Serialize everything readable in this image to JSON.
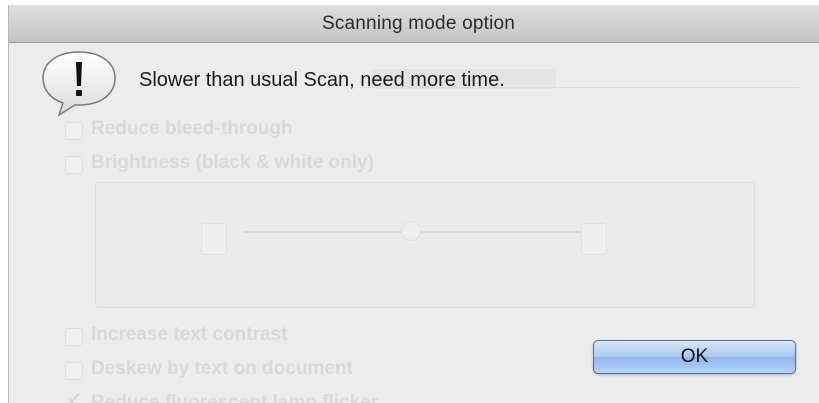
{
  "window": {
    "title": "Scanning mode option"
  },
  "alert": {
    "icon": "exclamation-icon",
    "message": "Slower than usual Scan, need more time."
  },
  "buttons": {
    "ok_label": "OK"
  },
  "background_panel": {
    "options": [
      {
        "label": "Reduce bleed-through",
        "checked": false
      },
      {
        "label": "Brightness (black & white only)",
        "checked": false
      },
      {
        "label": "Increase text contrast",
        "checked": false
      },
      {
        "label": "Deskew by text on document",
        "checked": false
      },
      {
        "label": "Reduce fluorescent lamp flicker",
        "checked": true
      }
    ]
  },
  "colors": {
    "button_blue": "#a9c8f2",
    "window_bg": "#ececec"
  }
}
